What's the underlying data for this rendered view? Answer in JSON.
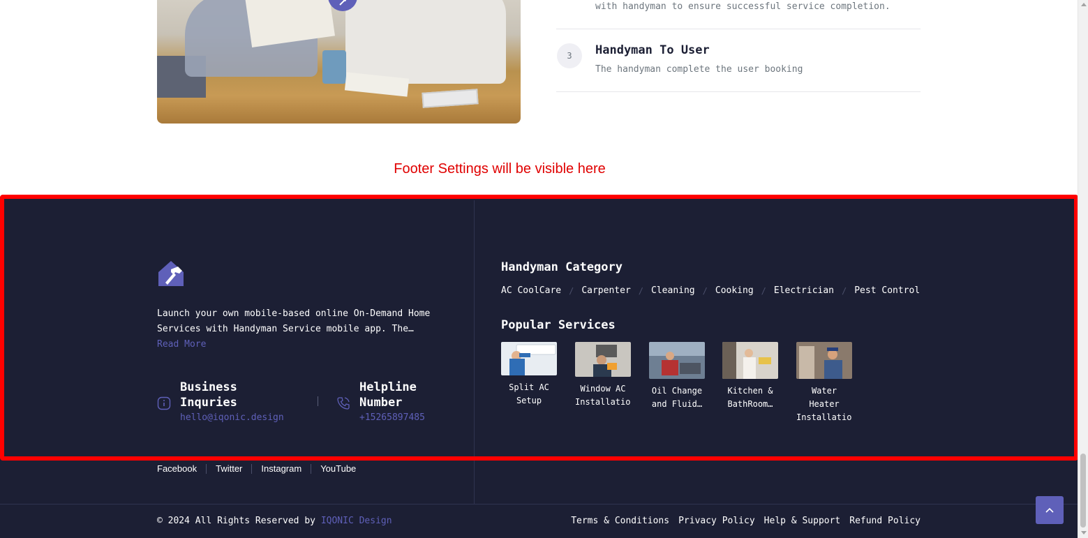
{
  "steps": {
    "previous_desc_tail": "with handyman to ensure successful service completion.",
    "current": {
      "number": "3",
      "title": "Handyman To User",
      "description": "The handyman complete the user booking"
    }
  },
  "notice": "Footer Settings will be visible here",
  "footer": {
    "about_text": "Launch your own mobile-based online On-Demand Home Services with Handyman Service mobile app. The…",
    "read_more": "Read More",
    "business": {
      "title": "Business Inquries",
      "email": "hello@iqonic.design",
      "icon": "info-icon"
    },
    "helpline": {
      "title": "Helpline Number",
      "phone": "+15265897485",
      "icon": "phone-icon"
    },
    "category_title": "Handyman Category",
    "categories": [
      "AC CoolCare",
      "Carpenter",
      "Cleaning",
      "Cooking",
      "Electrician",
      "Pest Control"
    ],
    "services_title": "Popular Services",
    "services": [
      {
        "label": "Split AC Setup"
      },
      {
        "label": "Window AC Installation"
      },
      {
        "label": "Oil Change and Fluid…"
      },
      {
        "label": "Kitchen & BathRoom…"
      },
      {
        "label": "Water Heater Installation"
      }
    ],
    "social": [
      "Facebook",
      "Twitter",
      "Instagram",
      "YouTube"
    ],
    "copyright_prefix": "© 2024 All Rights Reserved by",
    "copyright_brand": "IQONIC Design",
    "legal": [
      "Terms & Conditions",
      "Privacy Policy",
      "Help & Support",
      "Refund Policy"
    ]
  },
  "colors": {
    "footer_bg": "#1c1f34",
    "accent": "#5f60b9",
    "notice_red": "#e00000",
    "frame_red": "#ff0000"
  }
}
